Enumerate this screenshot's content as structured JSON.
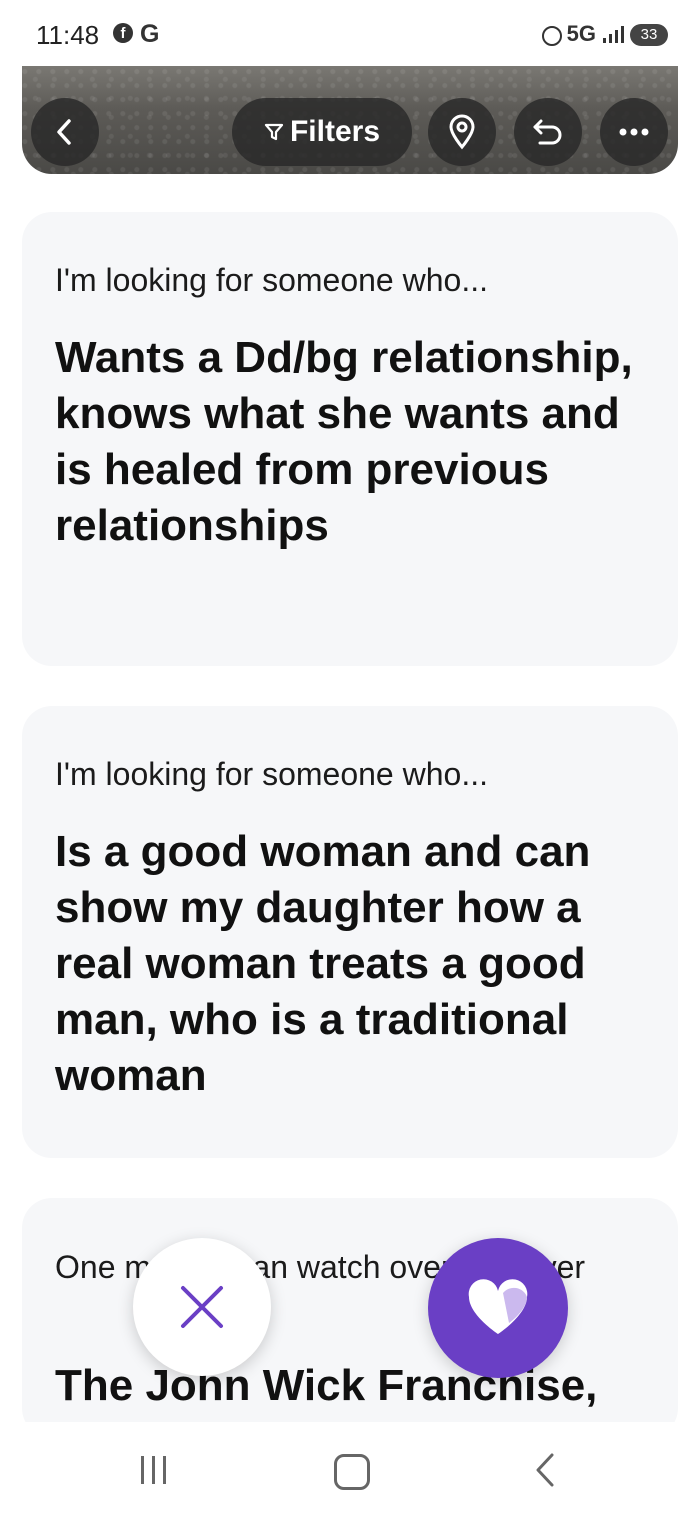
{
  "status_bar": {
    "time": "11:48",
    "app_letter": "G",
    "network": "5G",
    "battery": "33"
  },
  "header": {
    "filters_label": "Filters"
  },
  "cards": [
    {
      "prompt": "I'm looking for someone who...",
      "answer": "Wants a Dd/bg relationship, knows what she wants and is healed from previous relationships"
    },
    {
      "prompt": "I'm looking for someone who...",
      "answer": "Is a good woman and can show my daughter how a real woman treats a good man, who is a traditional woman"
    },
    {
      "prompt": "One movie I can watch over and over",
      "answer": "The John Wick Franchise,"
    }
  ],
  "colors": {
    "accent": "#6a3fc5",
    "card_bg": "#f6f7f9"
  },
  "icons": {
    "back": "chevron-left-icon",
    "filter": "filter-icon",
    "location": "location-pin-icon",
    "undo": "undo-icon",
    "more": "more-dots-icon",
    "pass": "close-x-icon",
    "like": "heart-icon"
  }
}
